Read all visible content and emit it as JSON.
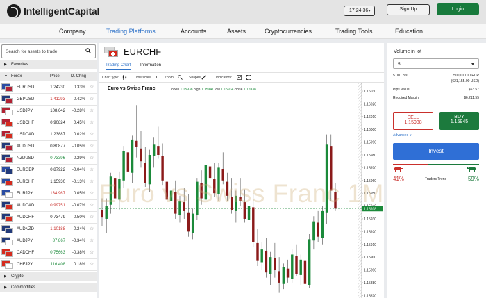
{
  "header": {
    "brand": "IntelligentCapital",
    "clock": "17:24:36",
    "signup_label": "Sign Up",
    "login_label": "Login"
  },
  "nav": {
    "items": [
      "Company",
      "Trading Platforms",
      "Accounts",
      "Assets",
      "Cryptocurrencies",
      "Trading Tools",
      "Education"
    ],
    "active": "Trading Platforms"
  },
  "left": {
    "search_placeholder": "Search for assets to trade",
    "favorites_label": "Favorites",
    "forex_label": "Forex",
    "col_price": "Price",
    "col_change": "D. Chng",
    "crypto_label": "Crypto",
    "commodities_label": "Commodities",
    "assets": [
      {
        "symbol": "EURUSD",
        "price": "1.24230",
        "change": "0.33%",
        "price_color": "#222222",
        "flag1": "#2b4da3",
        "flag2": "#b22234"
      },
      {
        "symbol": "GBPUSD",
        "price": "1.41293",
        "change": "0.42%",
        "price_color": "#c9302c",
        "flag1": "#223a7a",
        "flag2": "#b22234"
      },
      {
        "symbol": "USDJPY",
        "price": "108.642",
        "change": "-0.28%",
        "price_color": "#222222",
        "flag1": "#b22234",
        "flag2": "#ffffff"
      },
      {
        "symbol": "USDCHF",
        "price": "0.90824",
        "change": "0.45%",
        "price_color": "#222222",
        "flag1": "#b22234",
        "flag2": "#d52b1e"
      },
      {
        "symbol": "USDCAD",
        "price": "1.23887",
        "change": "0.02%",
        "price_color": "#222222",
        "flag1": "#b22234",
        "flag2": "#d52b1e"
      },
      {
        "symbol": "AUDUSD",
        "price": "0.80877",
        "change": "-0.05%",
        "price_color": "#222222",
        "flag1": "#223a7a",
        "flag2": "#b22234"
      },
      {
        "symbol": "NZDUSD",
        "price": "0.73396",
        "change": "0.29%",
        "price_color": "#1b8a3a",
        "flag1": "#223a7a",
        "flag2": "#b22234"
      },
      {
        "symbol": "EURGBP",
        "price": "0.87922",
        "change": "-0.04%",
        "price_color": "#222222",
        "flag1": "#2b4da3",
        "flag2": "#223a7a"
      },
      {
        "symbol": "EURCHF",
        "price": "1.15930",
        "change": "-0.13%",
        "price_color": "#222222",
        "flag1": "#2b4da3",
        "flag2": "#d52b1e"
      },
      {
        "symbol": "EURJPY",
        "price": "134.967",
        "change": "0.05%",
        "price_color": "#c9302c",
        "flag1": "#2b4da3",
        "flag2": "#ffffff"
      },
      {
        "symbol": "AUDCAD",
        "price": "0.99751",
        "change": "-0.07%",
        "price_color": "#c9302c",
        "flag1": "#223a7a",
        "flag2": "#d52b1e"
      },
      {
        "symbol": "AUDCHF",
        "price": "0.73479",
        "change": "-0.50%",
        "price_color": "#222222",
        "flag1": "#223a7a",
        "flag2": "#d52b1e"
      },
      {
        "symbol": "AUDNZD",
        "price": "1.10188",
        "change": "-0.24%",
        "price_color": "#c9302c",
        "flag1": "#223a7a",
        "flag2": "#223a7a"
      },
      {
        "symbol": "AUDJPY",
        "price": "87.867",
        "change": "-0.34%",
        "price_color": "#1b8a3a",
        "flag1": "#223a7a",
        "flag2": "#ffffff"
      },
      {
        "symbol": "CADCHF",
        "price": "0.75663",
        "change": "-0.38%",
        "price_color": "#1b8a3a",
        "flag1": "#d52b1e",
        "flag2": "#d52b1e"
      },
      {
        "symbol": "CHFJPY",
        "price": "116.408",
        "change": "0.18%",
        "price_color": "#1b8a3a",
        "flag1": "#d52b1e",
        "flag2": "#ffffff"
      }
    ]
  },
  "center": {
    "symbol": "EURCHF",
    "tab_chart": "Trading Chart",
    "tab_info": "Information",
    "toolbar": {
      "chart_type": "Chart type:",
      "time_scale": "Time scale",
      "time_scale_value": "1'",
      "zoom": "Zoom:",
      "shapes": "Shapes:",
      "indicators": "Indicators:"
    },
    "chart_title": "Euro vs Swiss Franc",
    "ohlc": {
      "open_label": "open",
      "open": "1.15938",
      "high_label": "high",
      "high": "1.15941",
      "low_label": "low",
      "low": "1.15934",
      "close_label": "close",
      "close": "1.15938"
    },
    "watermark": "Euro vs Swiss Franc 1M",
    "current_price": "1.15938",
    "price_axis_labels": [
      "1.16030",
      "1.16020",
      "1.16010",
      "1.16000",
      "1.15990",
      "1.15980",
      "1.15970",
      "1.15960",
      "1.15950",
      "1.15940",
      "1.15930",
      "1.15920",
      "1.15910",
      "1.15900",
      "1.15890",
      "1.15880",
      "1.15870"
    ]
  },
  "right": {
    "volume_label": "Volume in lot",
    "volume_value": "5",
    "lots_label": "5.00 Lots:",
    "lots_value": "500,000.00 EUR",
    "lots_sub": "(621,155.00 USD)",
    "pips_label": "Pips Value:",
    "pips_value": "$53.57",
    "margin_label": "Required Margin:",
    "margin_value": "$6,211.55",
    "sell_label": "SELL",
    "sell_price": "1.15938",
    "buy_label": "BUY",
    "buy_price": "1.15945",
    "advanced_label": "Advanced",
    "invest_label": "Invest",
    "sell_pct": "41%",
    "buy_pct": "59%",
    "trend_label": "Traders Trend",
    "sell_share": 0.41,
    "buy_share": 0.59
  },
  "colors": {
    "accent": "#2f73c9",
    "up": "#1b8a3a",
    "down": "#8b1a1a",
    "login": "#187a3c",
    "invest": "#2f6fd6"
  },
  "chart_data": {
    "type": "candlestick",
    "y_axis_labels": [
      "1.16030",
      "1.16020",
      "1.16010",
      "1.16000",
      "1.15990",
      "1.15980",
      "1.15970",
      "1.15960",
      "1.15950",
      "1.15940",
      "1.15930",
      "1.15920",
      "1.15910",
      "1.15900",
      "1.15890",
      "1.15880",
      "1.15870"
    ],
    "ylim": [
      1.15868,
      1.16036
    ],
    "candles": [
      {
        "o": 1.15937,
        "h": 1.15946,
        "l": 1.15924,
        "c": 1.15931
      },
      {
        "o": 1.1593,
        "h": 1.15946,
        "l": 1.15919,
        "c": 1.1594
      },
      {
        "o": 1.15941,
        "h": 1.15966,
        "l": 1.15934,
        "c": 1.15963
      },
      {
        "o": 1.15962,
        "h": 1.1597,
        "l": 1.15938,
        "c": 1.15946
      },
      {
        "o": 1.15945,
        "h": 1.15967,
        "l": 1.15937,
        "c": 1.15961
      },
      {
        "o": 1.1596,
        "h": 1.15987,
        "l": 1.15954,
        "c": 1.15983
      },
      {
        "o": 1.15982,
        "h": 1.16004,
        "l": 1.15964,
        "c": 1.15967
      },
      {
        "o": 1.15966,
        "h": 1.15995,
        "l": 1.15958,
        "c": 1.15992
      },
      {
        "o": 1.15991,
        "h": 1.16019,
        "l": 1.15978,
        "c": 1.15986
      },
      {
        "o": 1.15985,
        "h": 1.15999,
        "l": 1.1597,
        "c": 1.15975
      },
      {
        "o": 1.15974,
        "h": 1.15986,
        "l": 1.15955,
        "c": 1.15958
      },
      {
        "o": 1.15957,
        "h": 1.15984,
        "l": 1.15951,
        "c": 1.1598
      },
      {
        "o": 1.15979,
        "h": 1.15994,
        "l": 1.1597,
        "c": 1.15988
      },
      {
        "o": 1.15987,
        "h": 1.16002,
        "l": 1.15977,
        "c": 1.1598
      },
      {
        "o": 1.15979,
        "h": 1.15989,
        "l": 1.15956,
        "c": 1.1596
      },
      {
        "o": 1.15959,
        "h": 1.15972,
        "l": 1.15941,
        "c": 1.15945
      },
      {
        "o": 1.15944,
        "h": 1.15958,
        "l": 1.15936,
        "c": 1.15952
      },
      {
        "o": 1.15951,
        "h": 1.1596,
        "l": 1.1593,
        "c": 1.15934
      },
      {
        "o": 1.15933,
        "h": 1.15948,
        "l": 1.15927,
        "c": 1.15944
      },
      {
        "o": 1.15943,
        "h": 1.15954,
        "l": 1.1593,
        "c": 1.15936
      },
      {
        "o": 1.15935,
        "h": 1.15949,
        "l": 1.15916,
        "c": 1.1592
      },
      {
        "o": 1.15919,
        "h": 1.15938,
        "l": 1.15914,
        "c": 1.15934
      },
      {
        "o": 1.15933,
        "h": 1.15962,
        "l": 1.15929,
        "c": 1.15959
      },
      {
        "o": 1.15958,
        "h": 1.15968,
        "l": 1.15941,
        "c": 1.15946
      },
      {
        "o": 1.15945,
        "h": 1.15976,
        "l": 1.15941,
        "c": 1.15972
      },
      {
        "o": 1.15971,
        "h": 1.15982,
        "l": 1.15956,
        "c": 1.15962
      },
      {
        "o": 1.15961,
        "h": 1.15974,
        "l": 1.15947,
        "c": 1.1595
      },
      {
        "o": 1.15949,
        "h": 1.15974,
        "l": 1.15944,
        "c": 1.1597
      },
      {
        "o": 1.15969,
        "h": 1.15982,
        "l": 1.15957,
        "c": 1.1596
      },
      {
        "o": 1.15959,
        "h": 1.15966,
        "l": 1.15944,
        "c": 1.15948
      },
      {
        "o": 1.15947,
        "h": 1.15962,
        "l": 1.15934,
        "c": 1.15937
      },
      {
        "o": 1.15936,
        "h": 1.15952,
        "l": 1.15927,
        "c": 1.15948
      },
      {
        "o": 1.15947,
        "h": 1.15962,
        "l": 1.1594,
        "c": 1.15944
      },
      {
        "o": 1.15943,
        "h": 1.15953,
        "l": 1.15927,
        "c": 1.1593
      },
      {
        "o": 1.15929,
        "h": 1.15946,
        "l": 1.1592,
        "c": 1.1594
      },
      {
        "o": 1.15939,
        "h": 1.1595,
        "l": 1.15908,
        "c": 1.15912
      },
      {
        "o": 1.15911,
        "h": 1.15922,
        "l": 1.15893,
        "c": 1.15897
      },
      {
        "o": 1.15896,
        "h": 1.15912,
        "l": 1.1589,
        "c": 1.15906
      },
      {
        "o": 1.15905,
        "h": 1.15915,
        "l": 1.15884,
        "c": 1.15888
      },
      {
        "o": 1.15887,
        "h": 1.15904,
        "l": 1.15878,
        "c": 1.159
      },
      {
        "o": 1.15899,
        "h": 1.15911,
        "l": 1.15884,
        "c": 1.1589
      },
      {
        "o": 1.15889,
        "h": 1.159,
        "l": 1.15872,
        "c": 1.1588
      },
      {
        "o": 1.15879,
        "h": 1.15895,
        "l": 1.15875,
        "c": 1.15892
      },
      {
        "o": 1.15891,
        "h": 1.15898,
        "l": 1.1588,
        "c": 1.15884
      },
      {
        "o": 1.15883,
        "h": 1.15906,
        "l": 1.1588,
        "c": 1.15902
      },
      {
        "o": 1.15901,
        "h": 1.1591,
        "l": 1.15885,
        "c": 1.15887
      },
      {
        "o": 1.15886,
        "h": 1.15902,
        "l": 1.15878,
        "c": 1.15898
      },
      {
        "o": 1.15897,
        "h": 1.15904,
        "l": 1.15872,
        "c": 1.15879
      },
      {
        "o": 1.15878,
        "h": 1.15918,
        "l": 1.15876,
        "c": 1.15914
      },
      {
        "o": 1.15913,
        "h": 1.15932,
        "l": 1.15906,
        "c": 1.15928
      },
      {
        "o": 1.15927,
        "h": 1.15936,
        "l": 1.15912,
        "c": 1.15916
      },
      {
        "o": 1.15915,
        "h": 1.1594,
        "l": 1.1591,
        "c": 1.15936
      },
      {
        "o": 1.15935,
        "h": 1.15996,
        "l": 1.15926,
        "c": 1.15988
      },
      {
        "o": 1.15987,
        "h": 1.15996,
        "l": 1.15944,
        "c": 1.15952
      },
      {
        "o": 1.15951,
        "h": 1.15958,
        "l": 1.15936,
        "c": 1.15938
      }
    ]
  }
}
